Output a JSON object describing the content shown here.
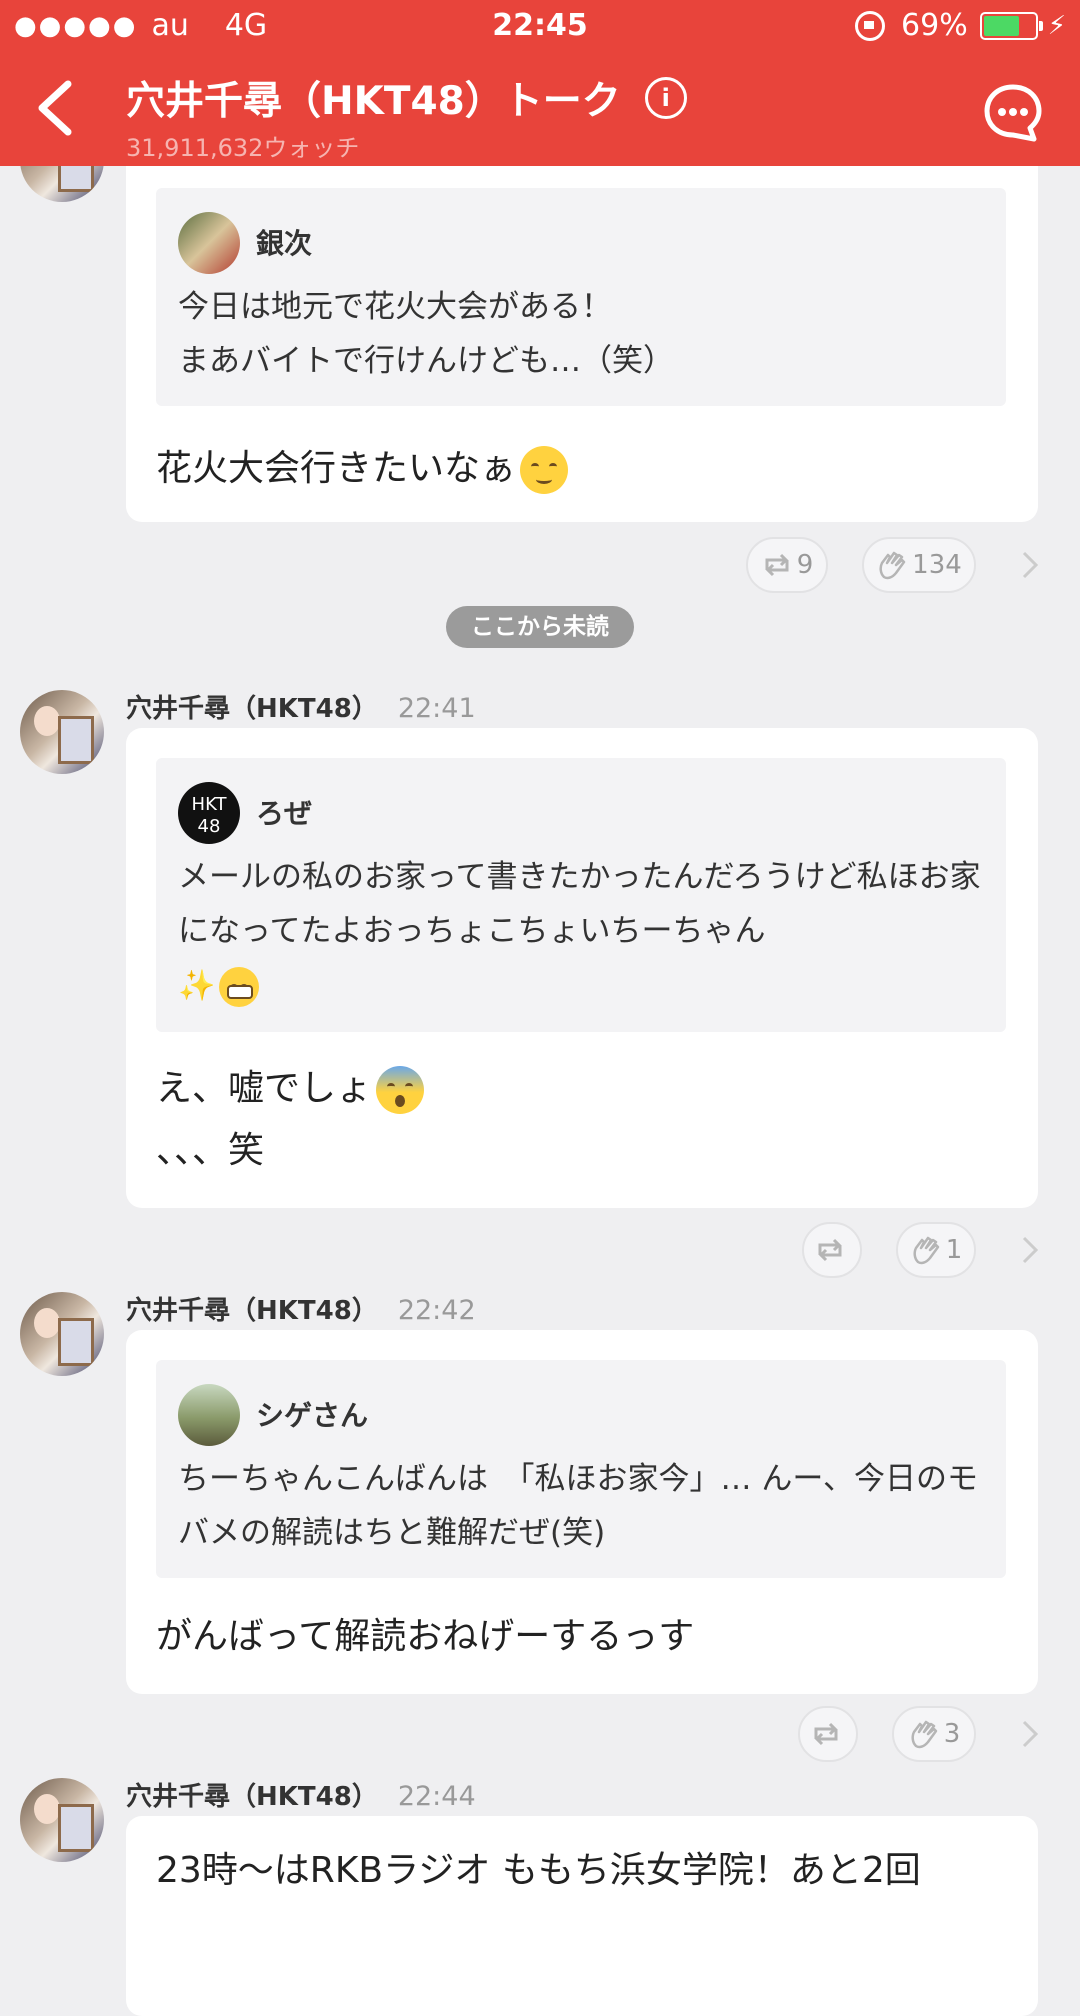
{
  "status_bar": {
    "signal": "●●●●●",
    "carrier": "au",
    "network": "4G",
    "time": "22:45",
    "battery_text": "69%",
    "battery_level": 0.69
  },
  "header": {
    "title": "穴井千尋（HKT48）トーク",
    "watch_count": "31,911,632ウォッチ"
  },
  "unread_divider": "ここから未読",
  "posts": [
    {
      "quote_name": "銀次",
      "quote_text": "今日は地元で花火大会がある！\nまあバイトで行けんけども…（笑）",
      "message": "花火大会行きたいなぁ",
      "retweets": "9",
      "claps": "134"
    },
    {
      "author": "穴井千尋（HKT48）",
      "time": "22:41",
      "quote_name": "ろぜ",
      "quote_text_1": "メールの私のお家って書きたかったんだろうけど私ほお家になってたよおっちょこちょいちーちゃん",
      "quote_sparkle": "✨",
      "message_line1": "え、嘘でしょ",
      "message_line2": "、、、笑",
      "retweets": "",
      "claps": "1"
    },
    {
      "author": "穴井千尋（HKT48）",
      "time": "22:42",
      "quote_name": "シゲさん",
      "quote_text": "ちーちゃんこんばんは　「私ほお家今」… んー、今日のモバメの解読はちと難解だぜ(笑)",
      "message": "がんばって解読おねげーするっす",
      "retweets": "",
      "claps": "3"
    },
    {
      "author": "穴井千尋（HKT48）",
      "time": "22:44",
      "message": "23時〜はRKBラジオ ももち浜女学院！あと2回"
    }
  ]
}
